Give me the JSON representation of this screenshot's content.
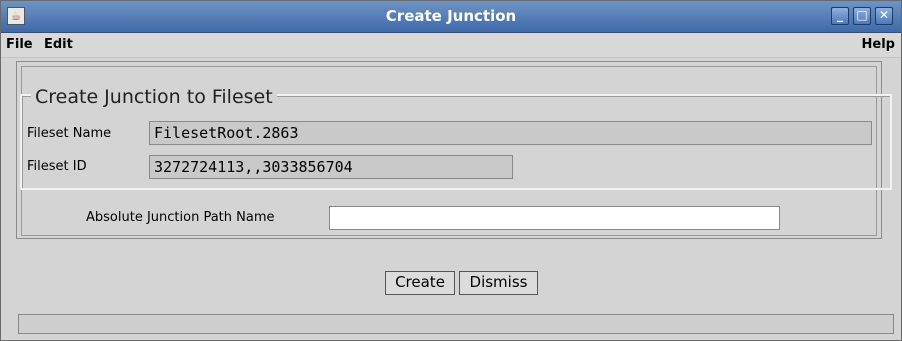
{
  "window": {
    "title": "Create Junction"
  },
  "menubar": {
    "file": "File",
    "edit": "Edit",
    "help": "Help"
  },
  "group": {
    "legend": "Create Junction to Fileset"
  },
  "fields": {
    "fileset_name_label": "Fileset Name",
    "fileset_name_value": "FilesetRoot.2863",
    "fileset_id_label": "Fileset ID",
    "fileset_id_value": "3272724113,,3033856704",
    "junction_path_label": "Absolute Junction Path Name",
    "junction_path_value": ""
  },
  "buttons": {
    "create": "Create",
    "dismiss": "Dismiss"
  },
  "status": {
    "text": ""
  }
}
